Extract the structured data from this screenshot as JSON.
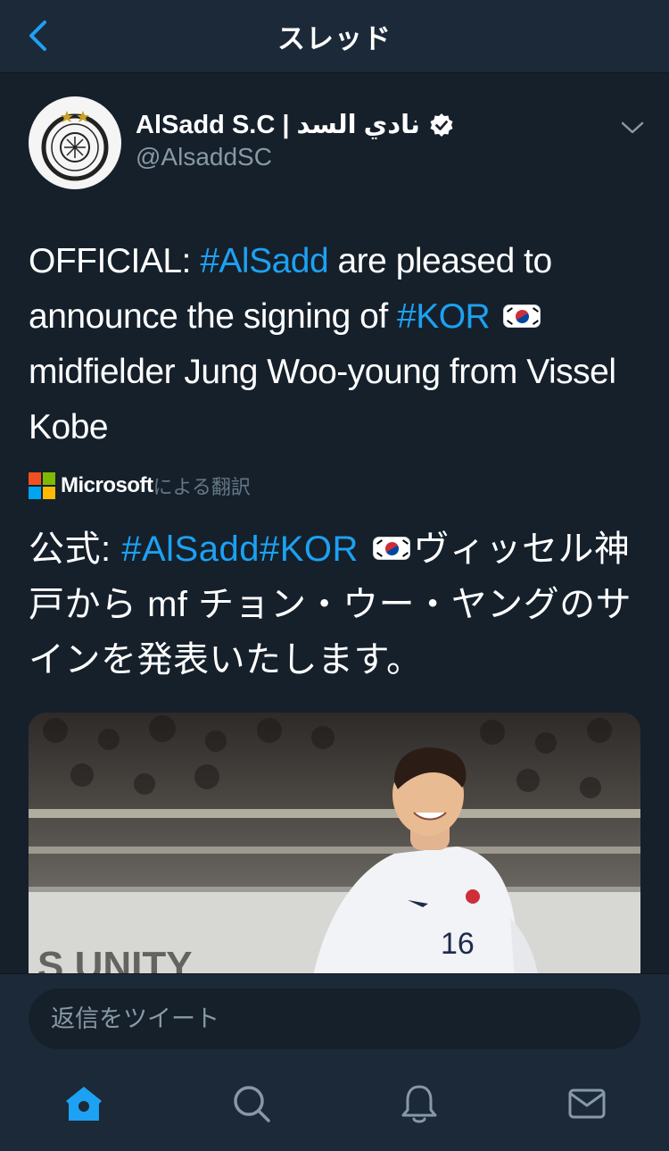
{
  "nav": {
    "title": "スレッド",
    "back_icon": "chevron-left-icon"
  },
  "tweet": {
    "author_name": "AlSadd S.C | نادي السد",
    "verified_icon": "verified-badge-icon",
    "handle": "@AlsaddSC",
    "text": {
      "part1": "OFFICIAL: ",
      "hashtag1": "#AlSadd",
      "part2": " are pleased to announce the signing of ",
      "hashtag2": "#KOR",
      "part3": " midfielder Jung Woo-young from Vissel Kobe"
    },
    "translation": {
      "brand": "Microsoft",
      "suffix": "による翻訳"
    },
    "translated_text": {
      "part1": "公式: ",
      "hashtag1": "#AlSadd",
      "hashtag2": "#KOR",
      "part2": "ヴィッセル神戸から mf チョン・ウー・ヤングのサインを発表いたします。"
    },
    "media_icon": "player-photo"
  },
  "reply": {
    "placeholder": "返信をツイート"
  },
  "tabbar": {
    "items": [
      {
        "name": "home",
        "icon": "home-icon",
        "active": true
      },
      {
        "name": "search",
        "icon": "search-icon",
        "active": false
      },
      {
        "name": "notifications",
        "icon": "bell-icon",
        "active": false
      },
      {
        "name": "messages",
        "icon": "mail-icon",
        "active": false
      }
    ]
  },
  "colors": {
    "background": "#15202b",
    "bar": "#1c2938",
    "accent": "#1da1f2",
    "secondary_text": "#8899a6"
  }
}
